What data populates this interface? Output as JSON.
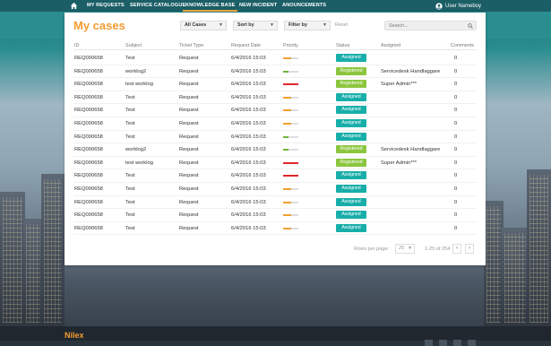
{
  "nav": {
    "items": [
      "MY REQUESTS",
      "SERVICE CATALOGUE",
      "KNOWLEDGE BASE",
      "NEW INCIDENT",
      "ANOUNCEMENTS"
    ],
    "active_index": 2,
    "user_name": "User Nameboy"
  },
  "page": {
    "title": "My cases",
    "filter_all": "All Cases",
    "sort_by": "Sort by",
    "filter_by": "Filter by",
    "reset": "Reset",
    "search_placeholder": "Search..."
  },
  "table": {
    "headers": [
      "ID",
      "Subject",
      "Ticket Type",
      "Request Date",
      "Priority",
      "Status",
      "Assigned",
      "Comments"
    ],
    "rows": [
      {
        "id": "REQ000658",
        "subject": "Test",
        "type": "Request",
        "date": "6/4/2016 15:03",
        "priority": 0.55,
        "priority_color": "#f0a031",
        "status": "Assigned",
        "status_color": "#18aeaa",
        "assigned": "",
        "comments": "0"
      },
      {
        "id": "REQ000658",
        "subject": "worklog2",
        "type": "Request",
        "date": "6/4/2016 15:03",
        "priority": 0.35,
        "priority_color": "#6fb43f",
        "status": "Registered",
        "status_color": "#8cc63f",
        "assigned": "Servicedesk Handlaggare",
        "comments": "0"
      },
      {
        "id": "REQ000658",
        "subject": "test worklog",
        "type": "Request",
        "date": "6/4/2016 15:03",
        "priority": 1.0,
        "priority_color": "#e0262d",
        "status": "Registered",
        "status_color": "#8cc63f",
        "assigned": "Super Admin***",
        "comments": "0"
      },
      {
        "id": "REQ000658",
        "subject": "Test",
        "type": "Request",
        "date": "6/4/2016 15:03",
        "priority": 0.55,
        "priority_color": "#f0a031",
        "status": "Assigned",
        "status_color": "#18aeaa",
        "assigned": "",
        "comments": "0"
      },
      {
        "id": "REQ000658",
        "subject": "Test",
        "type": "Request",
        "date": "6/4/2016 15:03",
        "priority": 0.55,
        "priority_color": "#f0a031",
        "status": "Assigned",
        "status_color": "#18aeaa",
        "assigned": "",
        "comments": "0"
      },
      {
        "id": "REQ000658",
        "subject": "Test",
        "type": "Request",
        "date": "6/4/2016 15:03",
        "priority": 0.55,
        "priority_color": "#f0a031",
        "status": "Assigned",
        "status_color": "#18aeaa",
        "assigned": "",
        "comments": "0"
      },
      {
        "id": "REQ000658",
        "subject": "Test",
        "type": "Request",
        "date": "6/4/2016 15:03",
        "priority": 0.35,
        "priority_color": "#6fb43f",
        "status": "Assigned",
        "status_color": "#18aeaa",
        "assigned": "",
        "comments": "0"
      },
      {
        "id": "REQ000658",
        "subject": "worklog2",
        "type": "Request",
        "date": "6/4/2016 15:03",
        "priority": 0.35,
        "priority_color": "#6fb43f",
        "status": "Registered",
        "status_color": "#8cc63f",
        "assigned": "Servicedesk Handlaggare",
        "comments": "0"
      },
      {
        "id": "REQ000658",
        "subject": "test worklog",
        "type": "Request",
        "date": "6/4/2016 15:03",
        "priority": 1.0,
        "priority_color": "#e0262d",
        "status": "Registered",
        "status_color": "#8cc63f",
        "assigned": "Super Admin***",
        "comments": "0"
      },
      {
        "id": "REQ000658",
        "subject": "Test",
        "type": "Request",
        "date": "6/4/2016 15:03",
        "priority": 1.0,
        "priority_color": "#e0262d",
        "status": "Assigned",
        "status_color": "#18aeaa",
        "assigned": "",
        "comments": "0"
      },
      {
        "id": "REQ000658",
        "subject": "Test",
        "type": "Request",
        "date": "6/4/2016 15:03",
        "priority": 0.55,
        "priority_color": "#f0a031",
        "status": "Assigned",
        "status_color": "#18aeaa",
        "assigned": "",
        "comments": "0"
      },
      {
        "id": "REQ000658",
        "subject": "Test",
        "type": "Request",
        "date": "6/4/2016 15:03",
        "priority": 0.55,
        "priority_color": "#f0a031",
        "status": "Assigned",
        "status_color": "#18aeaa",
        "assigned": "",
        "comments": "0"
      },
      {
        "id": "REQ000658",
        "subject": "Test",
        "type": "Request",
        "date": "6/4/2016 15:03",
        "priority": 0.55,
        "priority_color": "#f0a031",
        "status": "Assigned",
        "status_color": "#18aeaa",
        "assigned": "",
        "comments": "0"
      },
      {
        "id": "REQ000658",
        "subject": "Test",
        "type": "Request",
        "date": "6/4/2016 15:03",
        "priority": 0.55,
        "priority_color": "#f0a031",
        "status": "Assigned",
        "status_color": "#18aeaa",
        "assigned": "",
        "comments": "0"
      }
    ]
  },
  "pagination": {
    "rows_per_page_label": "Rows per page:",
    "rows_per_page": "25",
    "range": "1-25 of 254",
    "prev": "‹",
    "next": "›"
  },
  "footer": {
    "brand": "Nilex"
  },
  "icons": {
    "home": "home-icon",
    "user": "user-icon",
    "search": "search-icon",
    "caret": "chevron-down-icon"
  },
  "colors": {
    "accent": "#f39c33",
    "nav_bg": "#1b5e66",
    "band": "#2a8d8f",
    "assigned": "#18aeaa",
    "registered": "#8cc63f"
  }
}
